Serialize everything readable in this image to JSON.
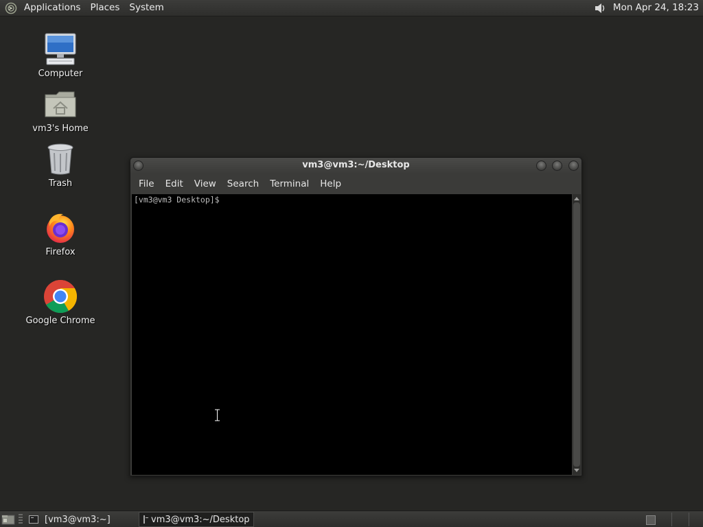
{
  "top_panel": {
    "menus": [
      "Applications",
      "Places",
      "System"
    ],
    "clock": "Mon Apr 24, 18:23",
    "icons": {
      "logo": "distro-logo-icon",
      "volume": "volume-icon"
    }
  },
  "desktop_icons": [
    {
      "label": "Computer",
      "icon": "computer-icon"
    },
    {
      "label": "vm3's Home",
      "icon": "home-folder-icon"
    },
    {
      "label": "Trash",
      "icon": "trash-icon"
    },
    {
      "label": "Firefox",
      "icon": "firefox-icon"
    },
    {
      "label": "Google Chrome",
      "icon": "chrome-icon"
    }
  ],
  "terminal": {
    "title": "vm3@vm3:~/Desktop",
    "menus": [
      "File",
      "Edit",
      "View",
      "Search",
      "Terminal",
      "Help"
    ],
    "prompt": "[vm3@vm3 Desktop]$"
  },
  "taskbar": {
    "tasks": [
      {
        "label": "[vm3@vm3:~]",
        "active": false
      },
      {
        "label": "vm3@vm3:~/Desktop",
        "active": true
      }
    ]
  },
  "colors": {
    "desktop_bg": "#262624",
    "panel_bg": "#333331",
    "terminal_bg": "#000000",
    "terminal_fg": "#bdbdbd"
  }
}
